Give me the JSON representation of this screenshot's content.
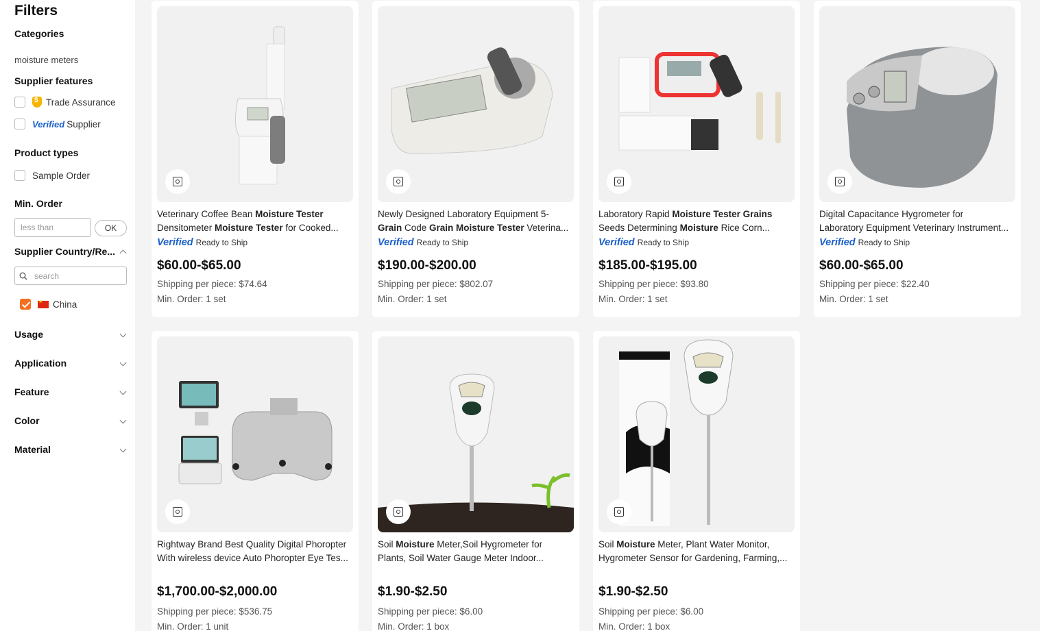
{
  "sidebar": {
    "title": "Filters",
    "categories": {
      "title": "Categories",
      "item": "moisture meters"
    },
    "supplier_features": {
      "title": "Supplier features",
      "trade_assurance": "Trade Assurance",
      "verified_mark": "Verified",
      "verified_supplier": "Supplier"
    },
    "product_types": {
      "title": "Product types",
      "sample_order": "Sample Order"
    },
    "min_order": {
      "title": "Min. Order",
      "placeholder": "less than",
      "ok": "OK"
    },
    "supplier_country": {
      "title": "Supplier Country/Re...",
      "search_placeholder": "search",
      "selected": "China"
    },
    "collapsed": [
      "Usage",
      "Application",
      "Feature",
      "Color",
      "Material"
    ]
  },
  "products": [
    {
      "title_line1": [
        {
          "t": "Veterinary Coffee Bean ",
          "b": false
        },
        {
          "t": "Moisture Tester",
          "b": true
        }
      ],
      "title_line2": [
        {
          "t": "Densitometer ",
          "b": false
        },
        {
          "t": "Moisture Tester",
          "b": true
        },
        {
          "t": " for Cooked...",
          "b": false
        }
      ],
      "verified": "Verified",
      "ready": "Ready to Ship",
      "price": "$60.00-$65.00",
      "shipping": "Shipping per piece: $74.64",
      "min_order": "Min. Order: 1 set"
    },
    {
      "title_line1": [
        {
          "t": "Newly Designed Laboratory Equipment 5-",
          "b": false
        }
      ],
      "title_line2": [
        {
          "t": "Grain",
          "b": true
        },
        {
          "t": " Code ",
          "b": false
        },
        {
          "t": "Grain Moisture Tester",
          "b": true
        },
        {
          "t": " Veterina...",
          "b": false
        }
      ],
      "verified": "Verified",
      "ready": "Ready to Ship",
      "price": "$190.00-$200.00",
      "shipping": "Shipping per piece: $802.07",
      "min_order": "Min. Order: 1 set"
    },
    {
      "title_line1": [
        {
          "t": "Laboratory Rapid ",
          "b": false
        },
        {
          "t": "Moisture Tester Grains",
          "b": true
        }
      ],
      "title_line2": [
        {
          "t": "Seeds Determining ",
          "b": false
        },
        {
          "t": "Moisture",
          "b": true
        },
        {
          "t": " Rice Corn...",
          "b": false
        }
      ],
      "verified": "Verified",
      "ready": "Ready to Ship",
      "price": "$185.00-$195.00",
      "shipping": "Shipping per piece: $93.80",
      "min_order": "Min. Order: 1 set"
    },
    {
      "title_line1": [
        {
          "t": "Digital Capacitance Hygrometer for",
          "b": false
        }
      ],
      "title_line2": [
        {
          "t": "Laboratory Equipment Veterinary Instrument...",
          "b": false
        }
      ],
      "verified": "Verified",
      "ready": "Ready to Ship",
      "price": "$60.00-$65.00",
      "shipping": "Shipping per piece: $22.40",
      "min_order": "Min. Order: 1 set"
    },
    {
      "title_line1": [
        {
          "t": "Rightway Brand Best Quality Digital Phoropter",
          "b": false
        }
      ],
      "title_line2": [
        {
          "t": "With wireless device Auto Phoropter Eye Tes...",
          "b": false
        }
      ],
      "verified": "",
      "ready": "",
      "price": "$1,700.00-$2,000.00",
      "shipping": "Shipping per piece: $536.75",
      "min_order": "Min. Order: 1 unit"
    },
    {
      "title_line1": [
        {
          "t": "Soil ",
          "b": false
        },
        {
          "t": "Moisture",
          "b": true
        },
        {
          "t": " Meter,Soil Hygrometer for",
          "b": false
        }
      ],
      "title_line2": [
        {
          "t": "Plants, Soil Water Gauge Meter Indoor...",
          "b": false
        }
      ],
      "verified": "",
      "ready": "",
      "price": "$1.90-$2.50",
      "shipping": "Shipping per piece: $6.00",
      "min_order": "Min. Order: 1 box"
    },
    {
      "title_line1": [
        {
          "t": "Soil ",
          "b": false
        },
        {
          "t": "Moisture",
          "b": true
        },
        {
          "t": " Meter, Plant Water Monitor,",
          "b": false
        }
      ],
      "title_line2": [
        {
          "t": "Hygrometer Sensor for Gardening, Farming,...",
          "b": false
        }
      ],
      "verified": "",
      "ready": "",
      "price": "$1.90-$2.50",
      "shipping": "Shipping per piece: $6.00",
      "min_order": "Min. Order: 1 box"
    }
  ]
}
